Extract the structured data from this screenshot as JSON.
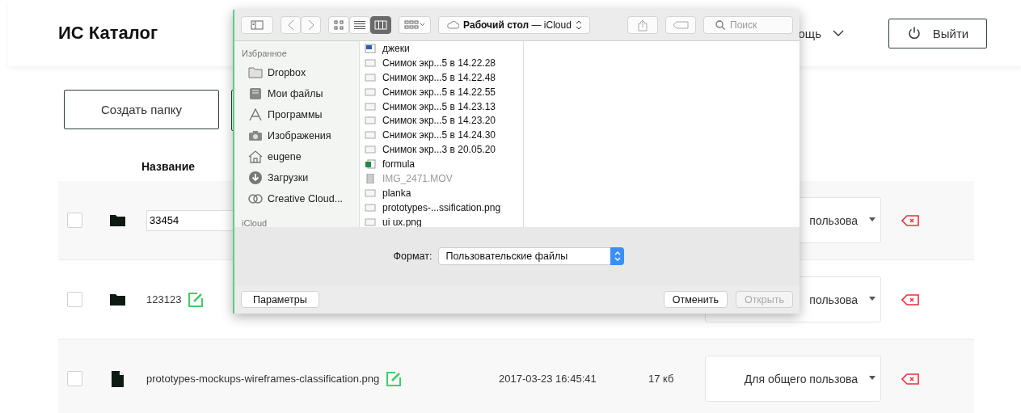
{
  "header": {
    "title": "ИС Каталог",
    "help_menu": "ощь",
    "logout_button": "Выйти"
  },
  "toolbar": {
    "create_folder_button": "Создать папку"
  },
  "table": {
    "name_column": "Название",
    "rows": [
      {
        "kind": "folder",
        "checked": false,
        "editing": true,
        "name": "33454",
        "access": "пользова"
      },
      {
        "kind": "folder",
        "checked": false,
        "editing": false,
        "name": "123123",
        "access": "пользова"
      },
      {
        "kind": "file",
        "checked": false,
        "editing": false,
        "name": "prototypes-mockups-wireframes-classification.png",
        "date": "2017-03-23 16:45:41",
        "size": "17 кб",
        "access": "Для общего пользова"
      }
    ]
  },
  "dialog": {
    "view_modes": [
      {
        "kind": "icons",
        "selected": false
      },
      {
        "kind": "list",
        "selected": false
      },
      {
        "kind": "columns",
        "selected": true
      }
    ],
    "location": "**Рабочий стол** — iCloud",
    "search": {
      "placeholder": "Поиск"
    },
    "sidebar": [
      {
        "heading": "Избранное",
        "items": [
          {
            "kind": "folder",
            "label": "Dropbox"
          },
          {
            "kind": "files",
            "label": "Мои файлы"
          },
          {
            "kind": "apps",
            "label": "Программы"
          },
          {
            "kind": "camera",
            "label": "Изображения"
          },
          {
            "kind": "home",
            "label": "eugene"
          },
          {
            "kind": "download",
            "label": "Загрузки"
          },
          {
            "kind": "cloud",
            "label": "Creative Cloud..."
          }
        ]
      },
      {
        "heading": "iCloud"
      }
    ],
    "files": [
      {
        "kind": "doc",
        "name": "джеки",
        "disabled": false
      },
      {
        "kind": "image",
        "name": "Снимок экр...5 в 14.22.28",
        "disabled": false
      },
      {
        "kind": "image",
        "name": "Снимок экр...5 в 14.22.48",
        "disabled": false
      },
      {
        "kind": "image",
        "name": "Снимок экр...5 в 14.22.55",
        "disabled": false
      },
      {
        "kind": "image",
        "name": "Снимок экр...5 в 14.23.13",
        "disabled": false
      },
      {
        "kind": "image",
        "name": "Снимок экр...5 в 14.23.20",
        "disabled": false
      },
      {
        "kind": "image",
        "name": "Снимок экр...5 в 14.24.30",
        "disabled": false
      },
      {
        "kind": "image",
        "name": "Снимок экр...3 в 20.05.20",
        "disabled": false
      },
      {
        "kind": "sheet",
        "name": "formula",
        "disabled": false
      },
      {
        "kind": "video",
        "name": "IMG_2471.MOV",
        "disabled": true
      },
      {
        "kind": "image",
        "name": "planka",
        "disabled": false
      },
      {
        "kind": "image",
        "name": "prototypes-...ssification.png",
        "disabled": false
      },
      {
        "kind": "image",
        "name": "ui ux.png",
        "disabled": false
      }
    ],
    "format_label": "Формат:",
    "format_value": "Пользовательские файлы",
    "buttons": [
      {
        "kind": "options",
        "label": "Параметры",
        "disabled": false
      },
      {
        "kind": "cancel",
        "label": "Отменить",
        "disabled": false
      },
      {
        "kind": "open",
        "label": "Открыть",
        "disabled": true
      }
    ]
  }
}
